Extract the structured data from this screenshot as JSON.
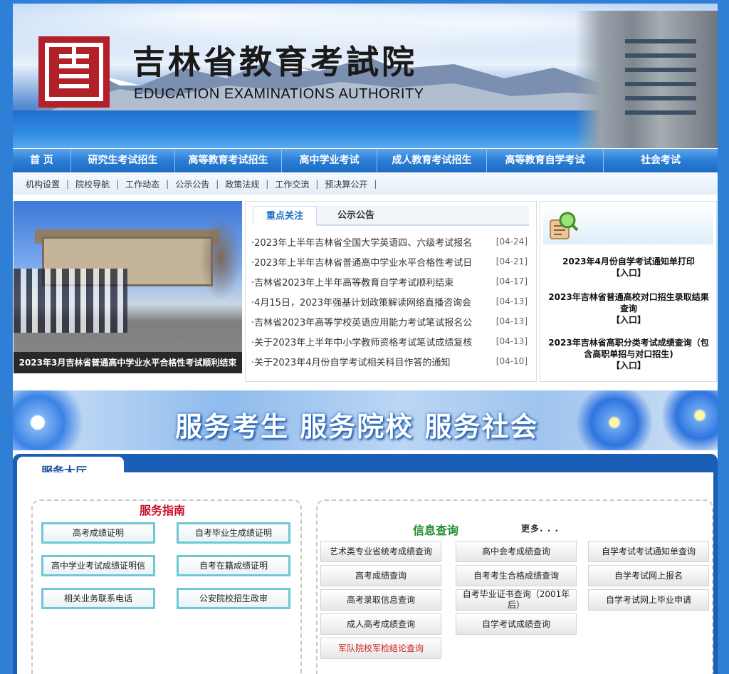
{
  "header": {
    "title": "吉林省教育考試院",
    "subtitle": "EDUCATION EXAMINATIONS AUTHORITY",
    "seal_icon": "red-seal-logo"
  },
  "nav": [
    {
      "label": "首 页"
    },
    {
      "label": "研究生考试招生"
    },
    {
      "label": "高等教育考试招生"
    },
    {
      "label": "高中学业考试"
    },
    {
      "label": "成人教育考试招生"
    },
    {
      "label": "高等教育自学考试"
    },
    {
      "label": "社会考试"
    }
  ],
  "subnav": [
    {
      "label": "机构设置"
    },
    {
      "label": "院校导航"
    },
    {
      "label": "工作动态"
    },
    {
      "label": "公示公告"
    },
    {
      "label": "政策法规"
    },
    {
      "label": "工作交流"
    },
    {
      "label": "预决算公开"
    }
  ],
  "subnav_sep": "|",
  "photo": {
    "caption": "2023年3月吉林省普通高中学业水平合格性考试顺利结束"
  },
  "news": {
    "tabs": [
      {
        "label": "重点关注",
        "active": true
      },
      {
        "label": "公示公告",
        "active": false
      }
    ],
    "items": [
      {
        "title": "·2023年上半年吉林省全国大学英语四、六级考试报名",
        "date": "[04-24]"
      },
      {
        "title": "·2023年上半年吉林省普通高中学业水平合格性考试日",
        "date": "[04-21]"
      },
      {
        "title": "·吉林省2023年上半年高等教育自学考试顺利结束",
        "date": "[04-17]"
      },
      {
        "title": "·4月15日，2023年强基计划政策解读网络直播咨询会",
        "date": "[04-13]"
      },
      {
        "title": "·吉林省2023年高等学校英语应用能力考试笔试报名公",
        "date": "[04-13]"
      },
      {
        "title": "·关于2023年上半年中小学教师资格考试笔试成绩复核",
        "date": "[04-13]"
      },
      {
        "title": "·关于2023年4月份自学考试相关科目作答的通知",
        "date": "[04-10]"
      }
    ]
  },
  "quick_links": {
    "icon": "magnifier-document-icon",
    "items": [
      {
        "title": "2023年4月份自学考试通知单打印",
        "entry": "【入口】"
      },
      {
        "title": "2023年吉林省普通高校对口招生录取结果查询",
        "entry": "【入口】"
      },
      {
        "title": "2023年吉林省高职分类考试成绩查询（包含高职单招与对口招生)",
        "entry": "【入口】"
      }
    ]
  },
  "slogan": "服务考生 服务院校 服务社会",
  "hall": {
    "title": "服务大厅",
    "guide": {
      "title": "服务指南",
      "buttons": [
        {
          "label": "高考成绩证明"
        },
        {
          "label": "自考毕业生成绩证明"
        },
        {
          "label": "高中学业考试成绩证明信"
        },
        {
          "label": "自考在籍成绩证明"
        },
        {
          "label": "相关业务联系电话"
        },
        {
          "label": "公安院校招生政审"
        }
      ]
    },
    "query": {
      "title": "信息查询",
      "more": "更多. . .",
      "buttons": [
        {
          "label": "艺术类专业省统考成绩查询"
        },
        {
          "label": "高中会考成绩查询"
        },
        {
          "label": "自学考试考试通知单查询"
        },
        {
          "label": "高考成绩查询"
        },
        {
          "label": "自考考生合格成绩查询"
        },
        {
          "label": "自学考试网上报名"
        },
        {
          "label": "高考录取信息查询"
        },
        {
          "label": "自考毕业证书查询（2001年后）"
        },
        {
          "label": "自学考试网上毕业申请"
        },
        {
          "label": "成人高考成绩查询"
        },
        {
          "label": "自学考试成绩查询"
        },
        {
          "label": "军队院校军检结论查询"
        }
      ]
    }
  },
  "colors": {
    "nav_blue": "#2a7ed6",
    "guide_title": "#c8102e",
    "query_title": "#1f8a2c",
    "alert_red": "#d0201c"
  }
}
